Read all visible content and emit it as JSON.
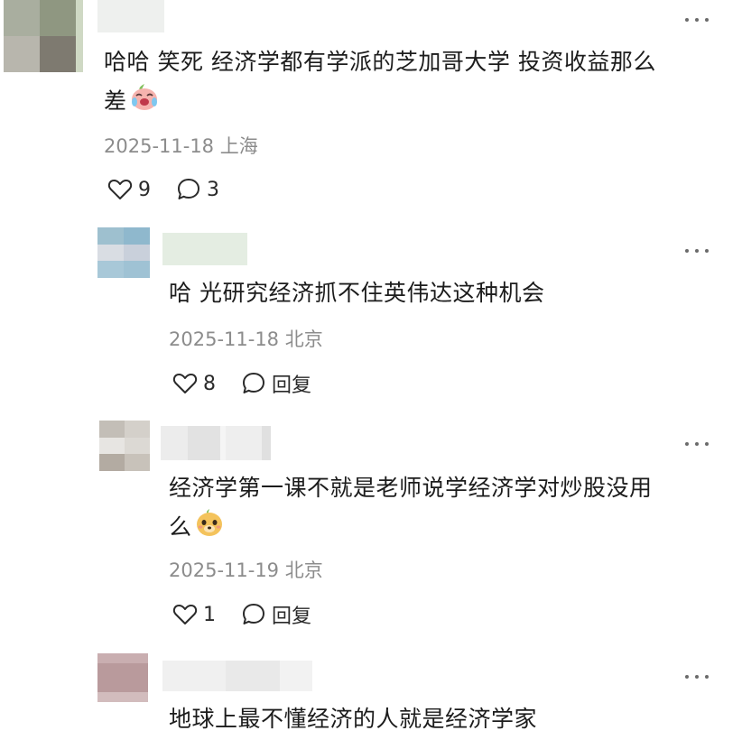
{
  "comments": [
    {
      "text_lines": [
        "哈哈 笑死 经济学都有学派的芝加哥大学 投资收益那么",
        "差"
      ],
      "date": "2025-11-18",
      "location": "上海",
      "likes": "9",
      "replies": "3",
      "emoji": "laughing-crying-emoji"
    },
    {
      "text_lines": [
        "哈 光研究经济抓不住英伟达这种机会"
      ],
      "date": "2025-11-18",
      "location": "北京",
      "likes": "8",
      "reply_label": "回复"
    },
    {
      "text_lines": [
        "经济学第一课不就是老师说学经济学对炒股没用",
        "么"
      ],
      "date": "2025-11-19",
      "location": "北京",
      "likes": "1",
      "reply_label": "回复",
      "emoji": "smug-face-emoji"
    },
    {
      "text_lines": [
        "地球上最不懂经济的人就是经济学家"
      ]
    }
  ],
  "colors": {
    "text": "#1c1c1c",
    "meta": "#8c8c8c",
    "icon": "#2a2a2a"
  }
}
